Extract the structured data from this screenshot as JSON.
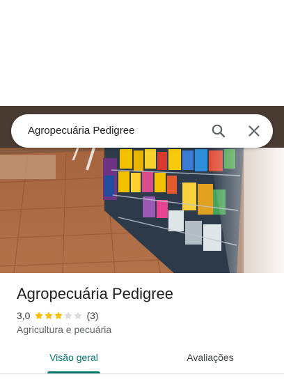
{
  "search": {
    "query": "Agropecuária Pedigree",
    "search_icon": "search-icon",
    "close_icon": "close-icon"
  },
  "place": {
    "name": "Agropecuária Pedigree",
    "rating": "3,0",
    "rating_stars": 3,
    "rating_max": 5,
    "review_count": "(3)",
    "category": "Agricultura e pecuária"
  },
  "tabs": [
    {
      "label": "Visão geral",
      "selected": true
    },
    {
      "label": "Avaliações",
      "selected": false
    }
  ],
  "colors": {
    "accent": "#00796b",
    "star_filled": "#fbbc04",
    "star_empty": "#dadce0"
  }
}
